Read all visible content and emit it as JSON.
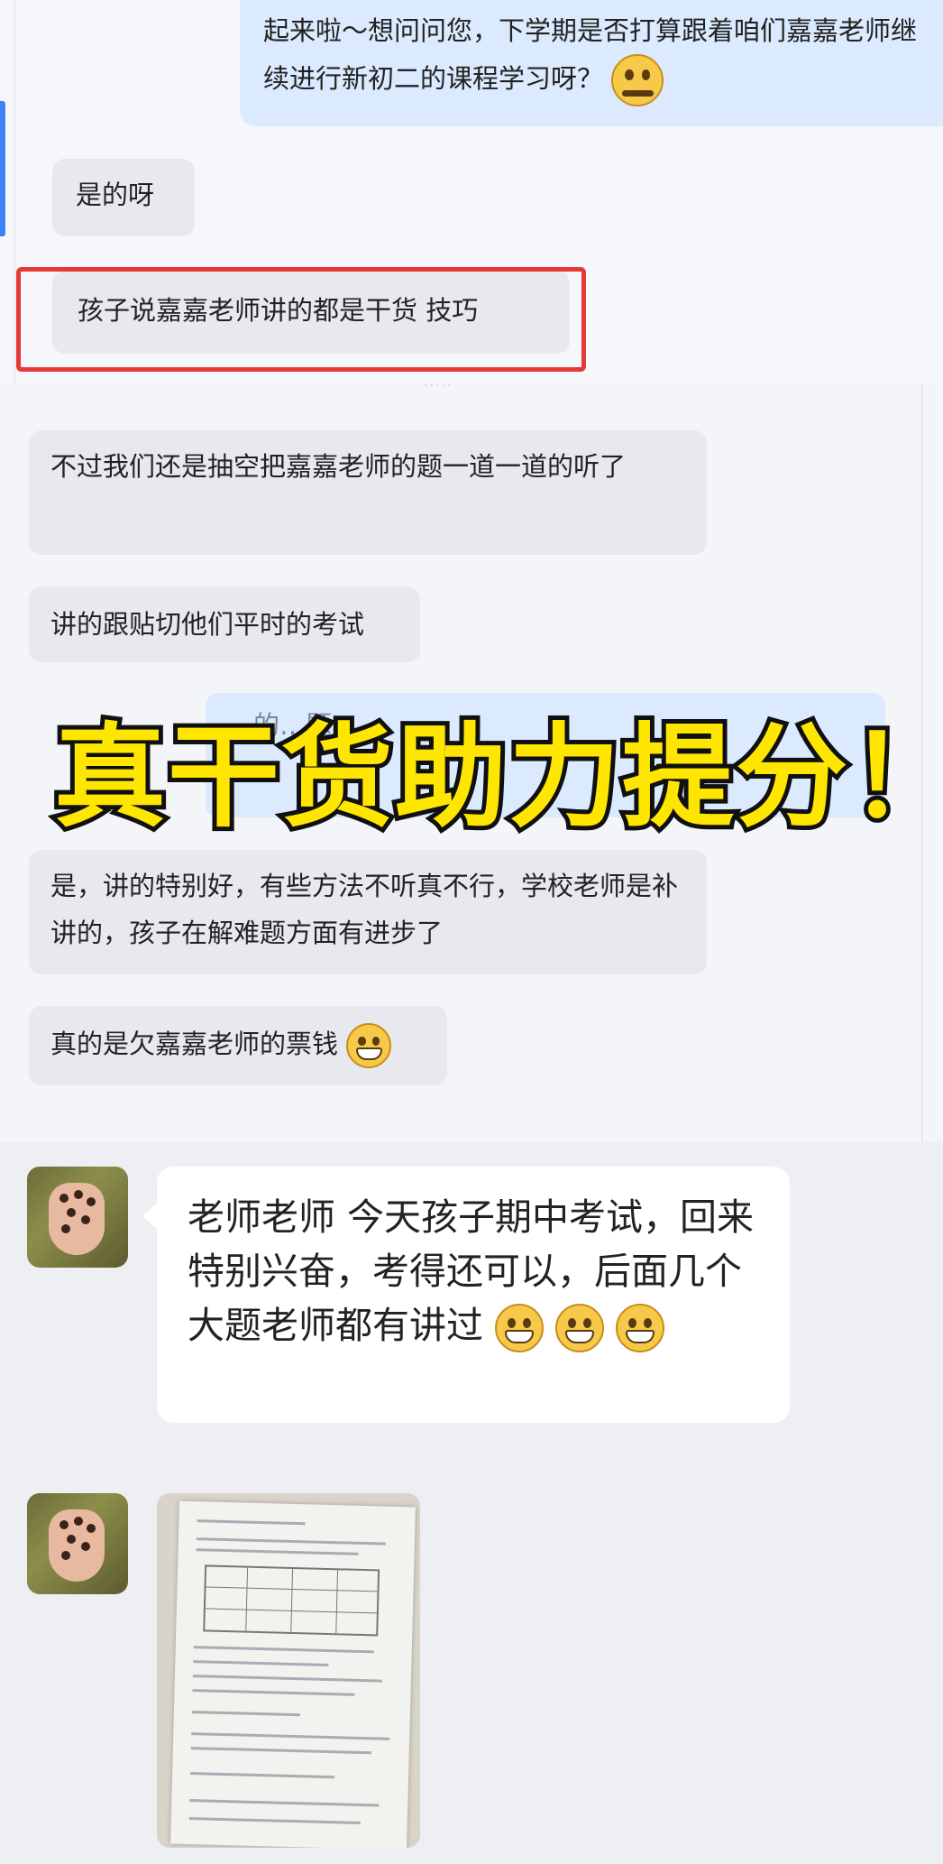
{
  "chat_top": {
    "messages": [
      {
        "side": "right",
        "text": "起来啦～想问问您，下学期是否打算跟着咱们嘉嘉老师继续进行新初二的课程学习呀？",
        "emoji": "thinking-face-emoji"
      },
      {
        "side": "left",
        "text": "是的呀"
      },
      {
        "side": "left",
        "text": "孩子说嘉嘉老师讲的都是干货 技巧",
        "highlighted": true
      }
    ]
  },
  "chat_middle": {
    "messages": [
      {
        "side": "left",
        "text": "不过我们还是抽空把嘉嘉老师的题一道一道的听了"
      },
      {
        "side": "left",
        "text": "讲的跟贴切他们平时的考试"
      },
      {
        "side": "right",
        "text": "…的…题…"
      },
      {
        "side": "left",
        "text": "是，讲的特别好，有些方法不听真不行，学校老师是补讲的，孩子在解难题方面有进步了"
      },
      {
        "side": "left",
        "text": "真的是欠嘉嘉老师的票钱",
        "emoji": "grinning-face-emoji"
      }
    ]
  },
  "overlay": {
    "text": "真干货助力提分！",
    "color": "#ffe600"
  },
  "chat_bottom": {
    "message_text": "老师老师 今天孩子期中考试，回来特别兴奋，考得还可以，后面几个大题老师都有讲过",
    "message_emojis": [
      "grinning-face-emoji",
      "grinning-face-emoji",
      "grinning-face-emoji"
    ],
    "photo_description": "exam-paper-photo"
  },
  "colors": {
    "highlight_border": "#e53935",
    "sent_bubble": "#dbeafe",
    "received_bubble": "#e7e9ee",
    "accent": "#3b82f6"
  }
}
